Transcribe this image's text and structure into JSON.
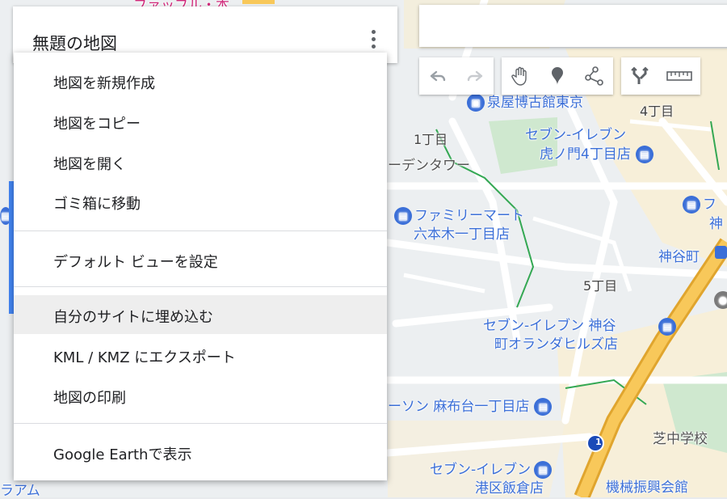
{
  "map": {
    "title": "無題の地図",
    "labels": {
      "top_partial": "ファッフル・本",
      "izumiya": "泉屋博古館東京",
      "chome4_top": "4丁目",
      "chome1": "1丁目",
      "seven_toranomon_1": "セブン-イレブン",
      "seven_toranomon_2": "虎ノ門4丁目店",
      "tower": "ーデンタワー",
      "famima_1": "ファミリーマート",
      "famima_2": "六本木一丁目店",
      "kamiyacho": "神谷町",
      "right_partial_1": "フ",
      "right_partial_2": "神",
      "chome5": "5丁目",
      "seven_kamiyacho_1": "セブン-イレブン 神谷",
      "seven_kamiyacho_2": "町オランダヒルズ店",
      "lawson": "ーソン 麻布台一丁目店",
      "shiba_school": "芝中学校",
      "seven_iikura_1": "セブン-イレブン",
      "seven_iikura_2": "港区飯倉店",
      "kikai": "機械振興会館",
      "bottom_left_partial": "ラアム",
      "route_shield": "1"
    }
  },
  "menu": {
    "items": [
      "地図を新規作成",
      "地図をコピー",
      "地図を開く",
      "ゴミ箱に移動",
      "デフォルト ビューを設定",
      "自分のサイトに埋め込む",
      "KML / KMZ にエクスポート",
      "地図の印刷",
      "Google Earthで表示"
    ],
    "highlighted": "自分のサイトに埋め込む"
  },
  "toolbar": {
    "icons": [
      "undo-icon",
      "redo-icon",
      "hand-icon",
      "marker-icon",
      "draw-line-icon",
      "directions-icon",
      "ruler-icon"
    ]
  },
  "colors": {
    "accent_blue": "#4285f4",
    "poi_blue": "#3b6fd8",
    "highway": "#f5b942",
    "menu_highlight": "#eeeeee"
  }
}
